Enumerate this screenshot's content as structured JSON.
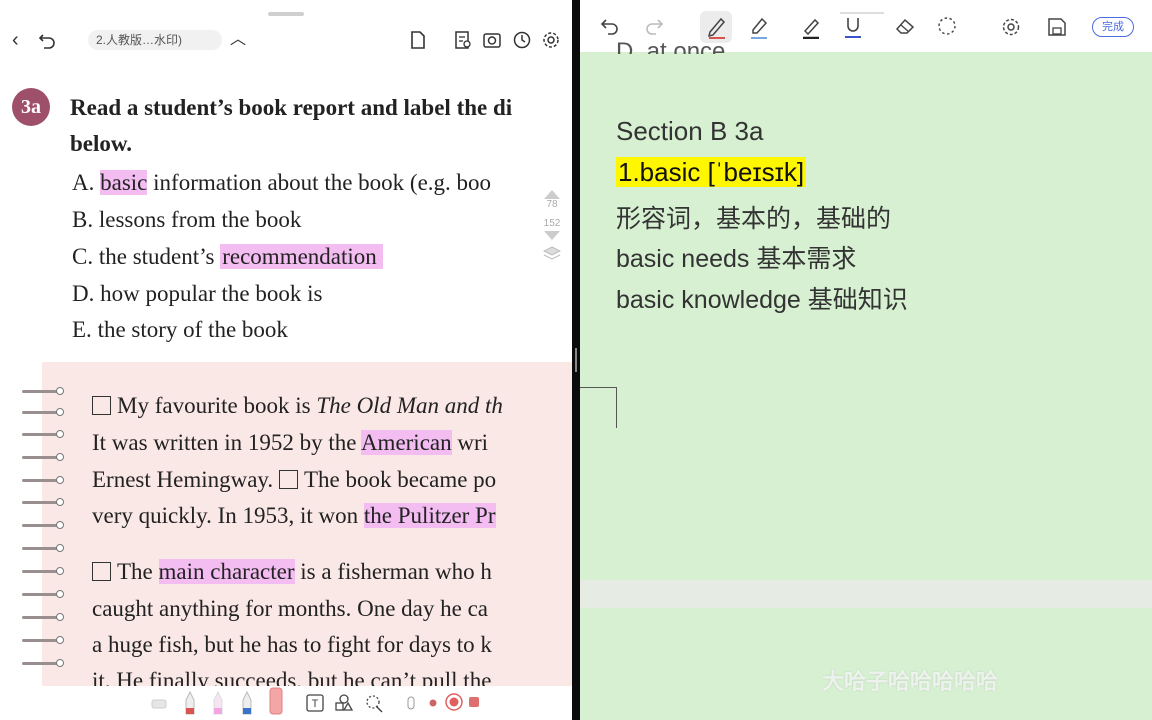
{
  "left_panel": {
    "doc_title": "2.人教版…水印)",
    "badge": "3a",
    "instruction_line1": "Read a student’s book report and label the di",
    "instruction_line2": "below.",
    "side_numbers": [
      "78",
      "152"
    ],
    "options": [
      {
        "letter": "A.",
        "pre": "",
        "highlight": "basic",
        "post": " information about the book (e.g. boo"
      },
      {
        "letter": "B.",
        "pre": "lessons from the book",
        "highlight": "",
        "post": ""
      },
      {
        "letter": "C.",
        "pre": "the student’s ",
        "highlight": "recommendation",
        "post": ""
      },
      {
        "letter": "D.",
        "pre": "how popular the book is",
        "highlight": "",
        "post": ""
      },
      {
        "letter": "E.",
        "pre": "the story of the book",
        "highlight": "",
        "post": ""
      }
    ],
    "passage": {
      "l1_pre": "My favourite book is ",
      "l1_italic": "The Old Man and th",
      "l2_pre": "It was written in 1952 by the ",
      "l2_hl": "American",
      "l2_post": " wri",
      "l3_pre": "Ernest Hemingway. ",
      "l3_post": "The book became po",
      "l4_pre": "very quickly. In 1953, it won ",
      "l4_hl": "the Pulitzer Pr",
      "l5_pre": "The ",
      "l5_hl": "main character",
      "l5_post": " is a fisherman who h",
      "l6": "caught anything for months. One day he ca",
      "l7": "a huge fish, but he has to fight for days to k",
      "l8": "it. He finally succeeds, but he can’t pull the"
    }
  },
  "right_panel": {
    "done_label": "完成",
    "cut_text": "D. at once",
    "section_title": "Section B 3a",
    "vocab_word": "1.basic [ˈbeɪsɪk]",
    "meaning": "形容词，基本的，基础的",
    "example1": "basic needs 基本需求",
    "example2": "basic knowledge 基础知识",
    "watermark": "大哈子哈哈哈哈哈"
  },
  "colors": {
    "note_bg": "#d7f0d2",
    "pink_highlight": "#f4bdf2",
    "yellow_highlight": "#fff700",
    "badge": "#9e4f6a",
    "accent": "#4a6de0"
  }
}
